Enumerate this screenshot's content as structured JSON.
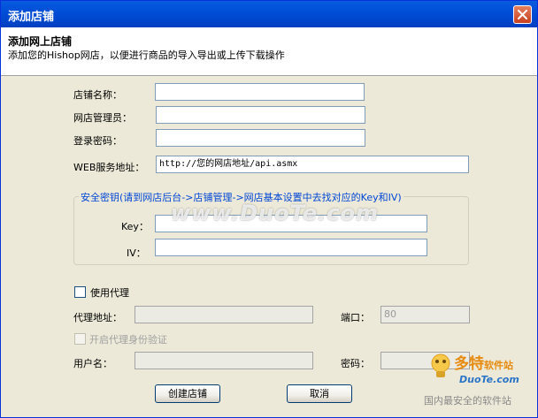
{
  "window": {
    "title": "添加店铺",
    "close_icon": "close-icon"
  },
  "header": {
    "title": "添加网上店铺",
    "description": "添加您的Hishop网店，以便进行商品的导入导出或上传下载操作"
  },
  "form": {
    "shop_name_label": "店铺名称：",
    "shop_name_value": "",
    "admin_label": "网店管理员：",
    "admin_value": "",
    "password_label": "登录密码：",
    "password_value": "",
    "web_service_label": "WEB服务地址：",
    "web_service_value": "http://您的网店地址/api.asmx"
  },
  "security": {
    "legend": "安全密钥(请到网店后台->店铺管理->网店基本设置中去找对应的Key和IV)",
    "key_label": "Key：",
    "key_value": "",
    "iv_label": "IV：",
    "iv_value": ""
  },
  "proxy": {
    "use_proxy_label": "使用代理",
    "use_proxy_checked": false,
    "address_label": "代理地址：",
    "address_value": "",
    "port_label": "端口：",
    "port_value": "80",
    "auth_label": "开启代理身份验证",
    "auth_checked": false,
    "username_label": "用户名：",
    "username_value": "",
    "password_label": "密码：",
    "password_value": ""
  },
  "buttons": {
    "create": "创建店铺",
    "cancel": "取消"
  },
  "watermark": "www.DuoTe.com",
  "logo": {
    "brand": "多特",
    "suffix": "软件站",
    "domain": "DuoTe.com",
    "slogan": "国内最安全的软件站"
  },
  "colors": {
    "titlebar": "#0054e3",
    "legend": "#0046d5",
    "dialog_bg": "#ece9d8"
  }
}
